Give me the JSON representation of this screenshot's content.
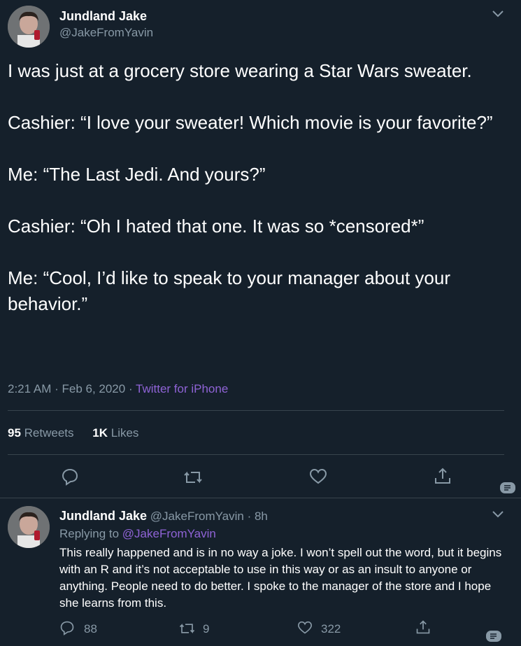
{
  "tweet": {
    "author_name": "Jundland Jake",
    "author_handle": "@JakeFromYavin",
    "text": "I was just at a grocery store wearing a Star Wars sweater.\n\nCashier: “I love your sweater! Which movie is your favorite?”\n\nMe: “The Last Jedi. And yours?”\n\nCashier: “Oh I hated that one. It was so *censored*”\n\nMe: “Cool, I’d like to speak to your manager about your behavior.”",
    "time": "2:21 AM · Feb 6, 2020 · ",
    "source": "Twitter for iPhone",
    "retweets_count": "95",
    "retweets_label": "Retweets",
    "likes_count": "1K",
    "likes_label": "Likes"
  },
  "reply": {
    "author_name": "Jundland Jake",
    "author_handle": "@JakeFromYavin · 8h",
    "replying_prefix": "Replying to ",
    "replying_to": "@JakeFromYavin",
    "text": "This really happened and is in no way a joke. I won’t spell out the word, but it begins with an R and it’s not acceptable to use in this way or as an insult to anyone or anything. People need to do better. I spoke to the manager of the store and I hope she learns from this.",
    "reply_count": "88",
    "retweet_count": "9",
    "like_count": "322"
  },
  "colors": {
    "background": "#15202b",
    "secondary_text": "#8899a6",
    "link": "#8f63d6",
    "divider": "#38444d"
  }
}
